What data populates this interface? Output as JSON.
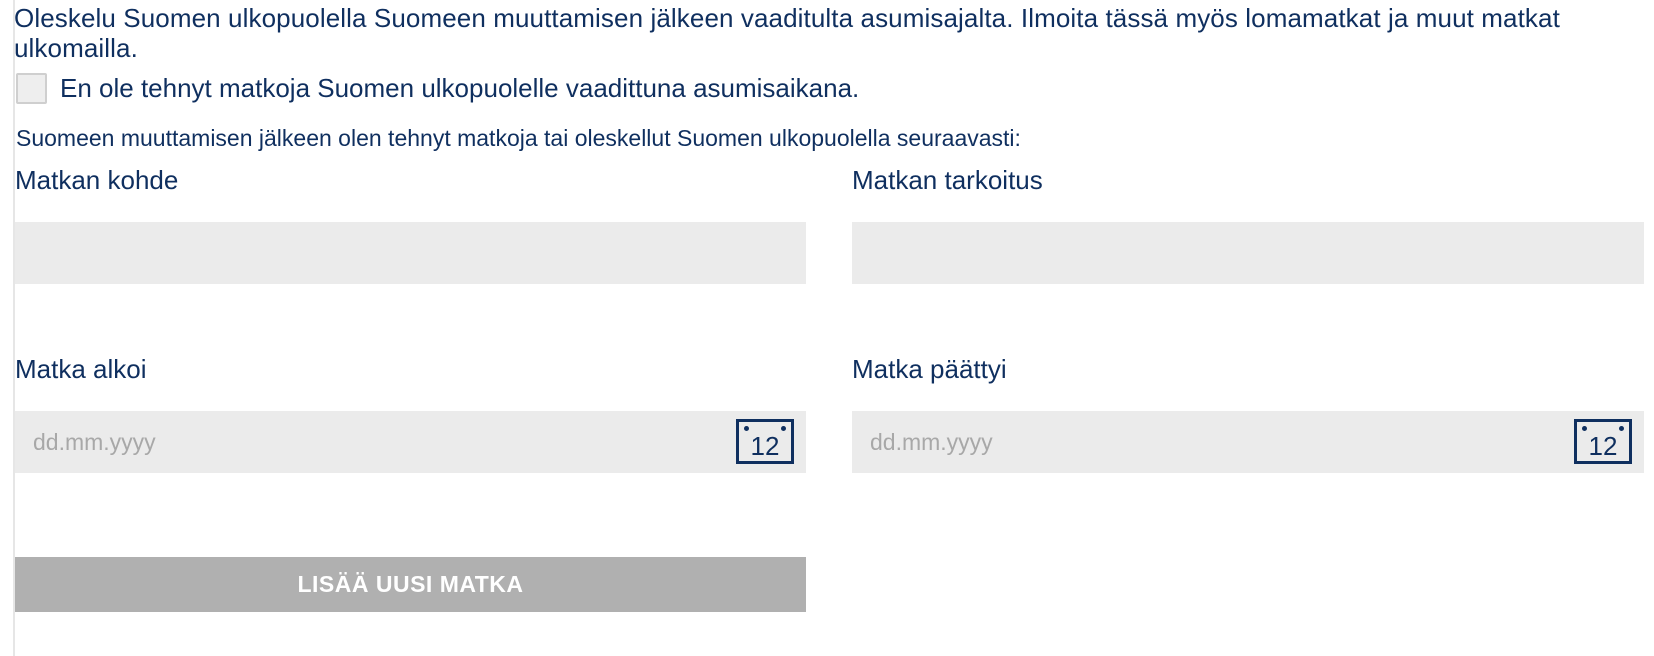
{
  "form": {
    "heading": "Oleskelu Suomen ulkopuolella Suomeen muuttamisen jälkeen vaaditulta asumisajalta. Ilmoita tässä myös lomamatkat ja muut matkat ulkomailla.",
    "no_trips_checkbox": {
      "label": "En ole tehnyt matkoja Suomen ulkopuolelle vaadittuna asumisaikana.",
      "checked": false
    },
    "intro_text": "Suomeen muuttamisen jälkeen olen tehnyt matkoja tai oleskellut Suomen ulkopuolella seuraavasti:",
    "destination": {
      "label": "Matkan kohde",
      "value": "",
      "placeholder": ""
    },
    "purpose": {
      "label": "Matkan tarkoitus",
      "value": "",
      "placeholder": ""
    },
    "start_date": {
      "label": "Matka alkoi",
      "value": "",
      "placeholder": "dd.mm.yyyy",
      "calendar_icon_text": "12"
    },
    "end_date": {
      "label": "Matka päättyi",
      "value": "",
      "placeholder": "dd.mm.yyyy",
      "calendar_icon_text": "12"
    },
    "add_button_label": "LISÄÄ UUSI MATKA"
  },
  "colors": {
    "text": "#0f2f5f",
    "input_bg": "#ebebeb",
    "button_bg": "#b0b0b0",
    "placeholder": "#a8a8a8"
  },
  "icons": {
    "calendar": "calendar-icon"
  }
}
